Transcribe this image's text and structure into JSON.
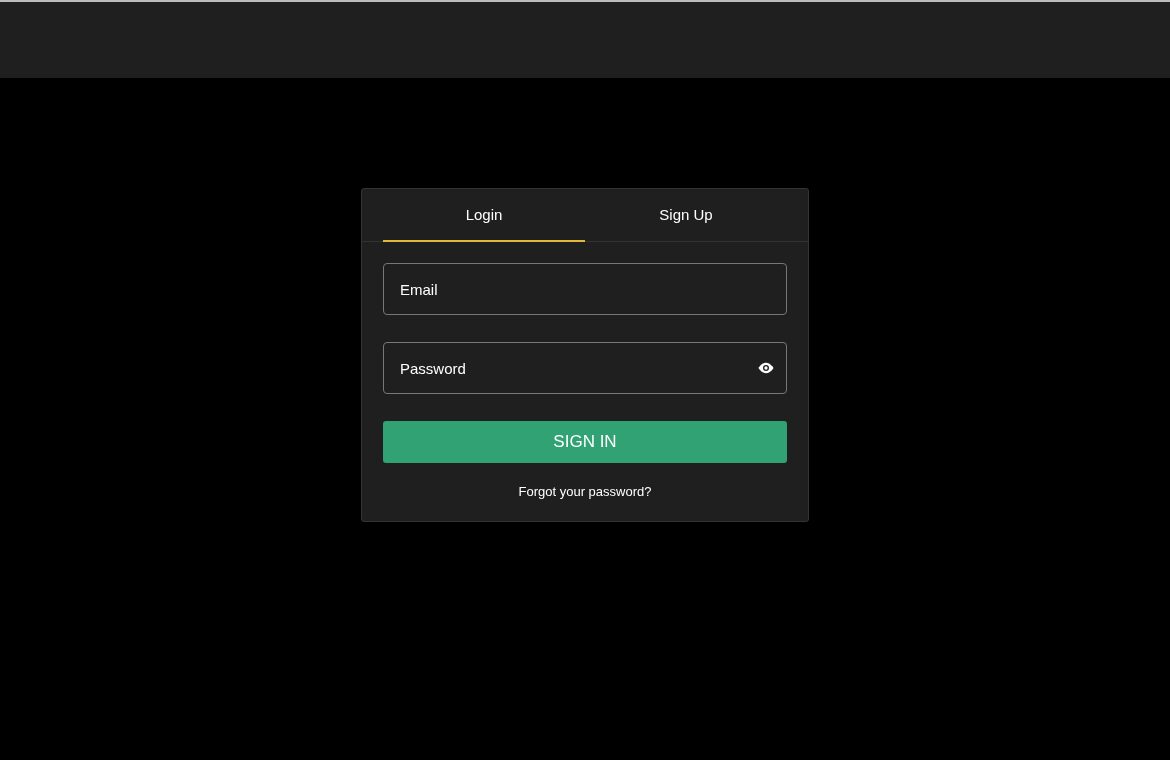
{
  "tabs": [
    {
      "label": "Login",
      "selected": true
    },
    {
      "label": "Sign Up",
      "selected": false
    }
  ],
  "email": {
    "placeholder": "Email"
  },
  "password": {
    "placeholder": "Password"
  },
  "submit": "SIGN IN",
  "forgot_link": "Forgot your password?"
}
